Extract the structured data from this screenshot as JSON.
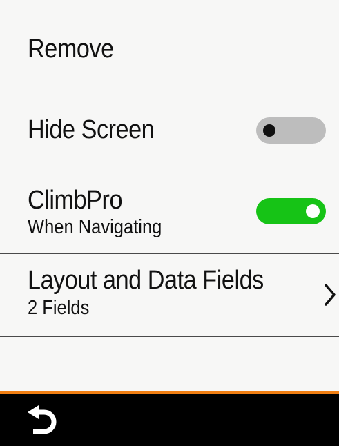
{
  "menu": {
    "remove": {
      "label": "Remove"
    },
    "hide_screen": {
      "label": "Hide Screen",
      "enabled": false
    },
    "climbpro": {
      "label": "ClimbPro",
      "sublabel": "When Navigating",
      "enabled": true
    },
    "layout": {
      "label": "Layout and Data Fields",
      "sublabel": "2 Fields"
    }
  },
  "colors": {
    "background": "#f7f7f6",
    "toggle_on": "#16c316",
    "toggle_off": "#bdbdbd",
    "accent_bar": "#f07f13",
    "footer": "#000000"
  },
  "icons": {
    "chevron": "chevron-right-icon",
    "back": "back-arrow-icon"
  }
}
